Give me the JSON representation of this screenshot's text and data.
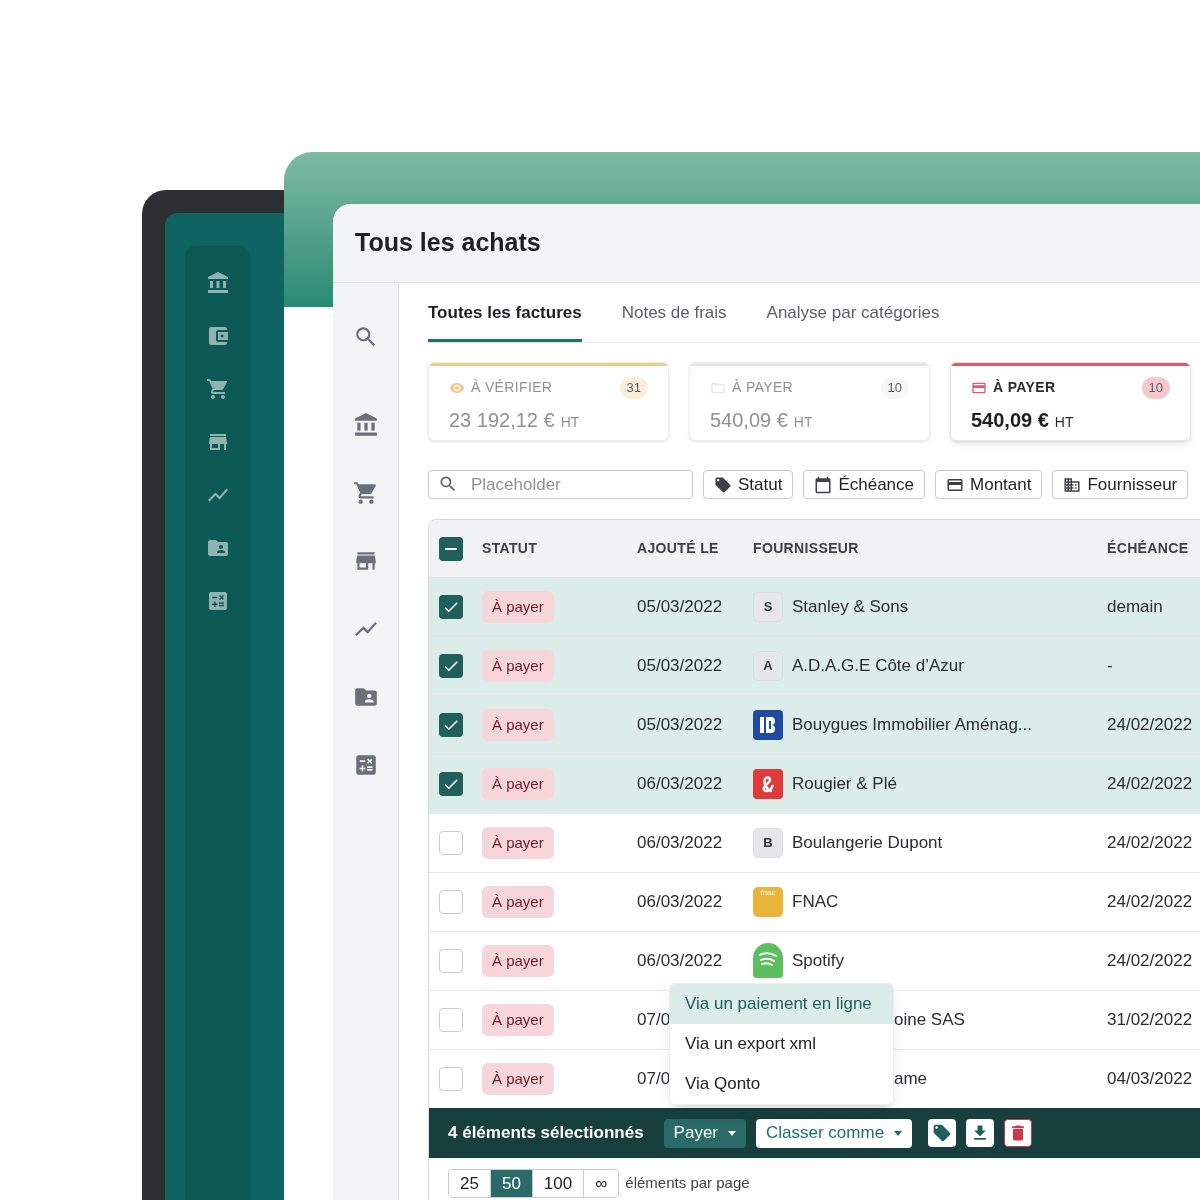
{
  "page": {
    "title": "Tous les achats"
  },
  "tabs": [
    {
      "label": "Toutes les factures",
      "selected": true
    },
    {
      "label": "Notes de frais",
      "selected": false
    },
    {
      "label": "Analyse par catégories",
      "selected": false
    }
  ],
  "cards": [
    {
      "kind": "eye",
      "label": "À VÉRIFIER",
      "count": "31",
      "amount": "23 192,12 €",
      "unit": "HT",
      "color": "#f3c98b",
      "selected": false
    },
    {
      "kind": "folder",
      "label": "À PAYER",
      "count": "10",
      "amount": "540,09 €",
      "unit": "HT",
      "color": "#e5e7eb",
      "selected": false
    },
    {
      "kind": "card",
      "label": "À PAYER",
      "count": "10",
      "amount": "540,09 €",
      "unit": "HT",
      "color": "#e05a6a",
      "selected": true
    }
  ],
  "search": {
    "placeholder": "Placeholder"
  },
  "filters": [
    {
      "kind": "tag",
      "label": "Statut"
    },
    {
      "kind": "calendar",
      "label": "Échéance"
    },
    {
      "kind": "card",
      "label": "Montant"
    },
    {
      "kind": "building",
      "label": "Fournisseur"
    }
  ],
  "table": {
    "header_checkbox": {
      "indeterminate": true
    },
    "columns": [
      "STATUT",
      "AJOUTÉ LE",
      "FOURNISSEUR",
      "ÉCHÉANCE"
    ],
    "rows": [
      {
        "checked": true,
        "status": "À payer",
        "date": "05/03/2022",
        "logo": {
          "kind": "letter",
          "text": "S"
        },
        "supplier": "Stanley & Sons",
        "due": "demain"
      },
      {
        "checked": true,
        "status": "À payer",
        "date": "05/03/2022",
        "logo": {
          "kind": "letter",
          "text": "A"
        },
        "supplier": "A.D.A.G.E Côte d’Azur",
        "due": "-"
      },
      {
        "checked": true,
        "status": "À payer",
        "date": "05/03/2022",
        "logo": {
          "kind": "bouygues"
        },
        "supplier": "Bouygues Immobilier Aménag...",
        "due": "24/02/2022"
      },
      {
        "checked": true,
        "status": "À payer",
        "date": "06/03/2022",
        "logo": {
          "kind": "rougier"
        },
        "supplier": "Rougier & Plé",
        "due": "24/02/2022"
      },
      {
        "checked": false,
        "status": "À payer",
        "date": "06/03/2022",
        "logo": {
          "kind": "letter",
          "text": "B"
        },
        "supplier": "Boulangerie Dupont",
        "due": "24/02/2022"
      },
      {
        "checked": false,
        "status": "À payer",
        "date": "06/03/2022",
        "logo": {
          "kind": "fnac",
          "text": "fnac"
        },
        "supplier": "FNAC",
        "due": "24/02/2022"
      },
      {
        "checked": false,
        "status": "À payer",
        "date": "06/03/2022",
        "logo": {
          "kind": "spotify"
        },
        "supplier": "Spotify",
        "due": "24/02/2022"
      },
      {
        "checked": false,
        "status": "À payer",
        "date": "07/0",
        "logo": {
          "kind": "covered"
        },
        "supplier": "oine SAS",
        "due": "31/02/2022"
      },
      {
        "checked": false,
        "status": "À payer",
        "date": "07/0",
        "logo": {
          "kind": "covered"
        },
        "supplier": "ame",
        "due": "04/03/2022"
      }
    ]
  },
  "menu": [
    {
      "label": "Via un paiement en ligne",
      "selected": true
    },
    {
      "label": "Via un export xml",
      "selected": false
    },
    {
      "label": "Via Qonto",
      "selected": false
    }
  ],
  "bulk_bar": {
    "count": "4 éléments sélectionnés",
    "pay_button": "Payer",
    "classify_button": "Classer comme"
  },
  "pagination": {
    "options": [
      {
        "label": "25",
        "selected": false
      },
      {
        "label": "50",
        "selected": true
      },
      {
        "label": "100",
        "selected": false
      },
      {
        "label": "∞",
        "selected": false
      }
    ],
    "label": "éléments par page"
  }
}
